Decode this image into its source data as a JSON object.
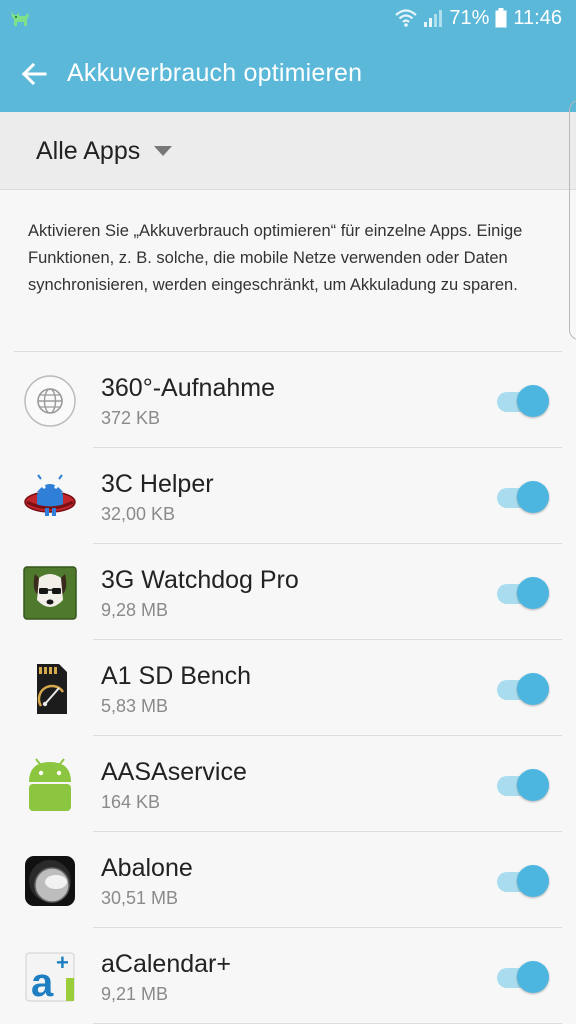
{
  "status_bar": {
    "notification_icon": "android-cat-icon",
    "icons": [
      "wifi-icon",
      "signal-icon"
    ],
    "battery_percent": "71%",
    "battery_icon": "battery-icon",
    "time": "11:46"
  },
  "app_bar": {
    "back_icon": "back-arrow-icon",
    "title": "Akkuverbrauch optimieren",
    "color": "#5bb8d9"
  },
  "filter": {
    "selected": "Alle Apps",
    "caret_icon": "dropdown-caret-icon"
  },
  "description": "Aktivieren Sie „Akkuverbrauch optimieren“ für einzelne Apps. Einige Funktionen, z. B. solche, die mobile Netze verwenden oder Daten synchronisieren, werden eingeschränkt, um Akkuladung zu sparen.",
  "apps": [
    {
      "name": "360°-Aufnahme",
      "size": "372 KB",
      "icon": "globe-icon",
      "enabled": true
    },
    {
      "name": "3C Helper",
      "size": "32,00 KB",
      "icon": "android-robot-helper-icon",
      "enabled": true
    },
    {
      "name": "3G Watchdog Pro",
      "size": "9,28 MB",
      "icon": "dog-with-sunglasses-icon",
      "enabled": true
    },
    {
      "name": "A1 SD Bench",
      "size": "5,83 MB",
      "icon": "sd-card-speedometer-icon",
      "enabled": true
    },
    {
      "name": "AASAservice",
      "size": "164 KB",
      "icon": "android-robot-icon",
      "enabled": true
    },
    {
      "name": "Abalone",
      "size": "30,51 MB",
      "icon": "marble-icon",
      "enabled": true
    },
    {
      "name": "aCalendar+",
      "size": "9,21 MB",
      "icon": "calendar-a-plus-icon",
      "enabled": true
    }
  ],
  "colors": {
    "accent": "#5bb8d9",
    "toggle_on": "#4db6e0",
    "toggle_track": "#a9dcee",
    "background": "#f7f7f7",
    "filter_background": "#ececec"
  }
}
